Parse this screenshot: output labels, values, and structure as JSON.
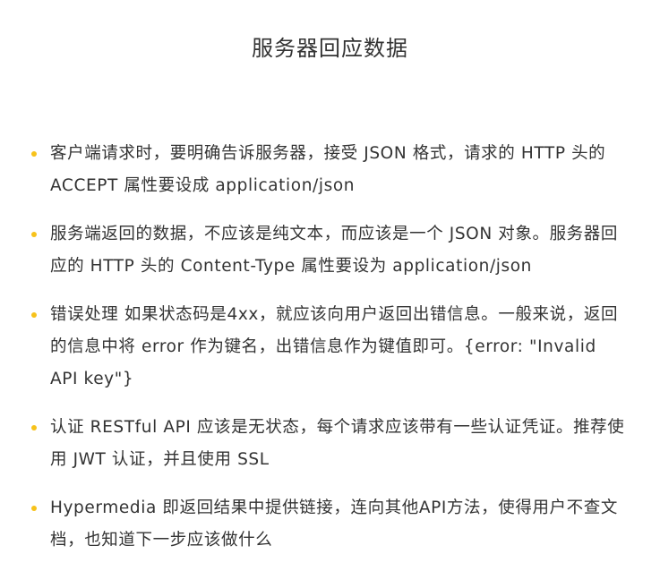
{
  "title": "服务器回应数据",
  "bullet_color": "#F7C21A",
  "items": [
    {
      "text": "客户端请求时，要明确告诉服务器，接受 JSON 格式，请求的 HTTP 头的 ACCEPT 属性要设成 application/json"
    },
    {
      "text": "服务端返回的数据，不应该是纯文本，而应该是一个 JSON 对象。服务器回应的 HTTP 头的 Content-Type 属性要设为 application/json"
    },
    {
      "text": "错误处理 如果状态码是4xx，就应该向用户返回出错信息。一般来说，返回的信息中将 error 作为键名，出错信息作为键值即可。{error: \"Invalid API key\"}"
    },
    {
      "text": "认证 RESTful API 应该是无状态，每个请求应该带有一些认证凭证。推荐使用 JWT 认证，并且使用 SSL"
    },
    {
      "text": "Hypermedia 即返回结果中提供链接，连向其他API方法，使得用户不查文档，也知道下一步应该做什么"
    }
  ]
}
